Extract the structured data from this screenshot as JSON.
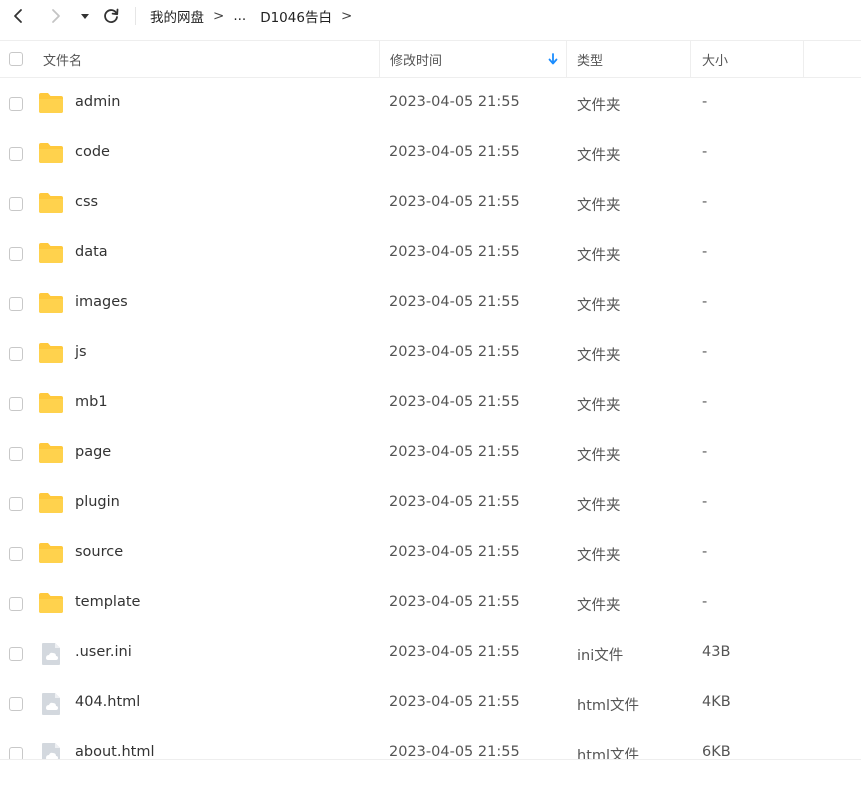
{
  "toolbar": {
    "back_icon": "chevron-left-icon",
    "forward_icon": "chevron-right-icon",
    "dropdown_icon": "caret-down-icon",
    "refresh_icon": "refresh-icon"
  },
  "breadcrumb": {
    "items": [
      "我的网盘",
      "...",
      "D1046告白"
    ],
    "separator": ">"
  },
  "table": {
    "columns": {
      "name": "文件名",
      "date": "修改时间",
      "type": "类型",
      "size": "大小"
    },
    "sort_icon": "arrow-down-icon",
    "sort_color": "#1a8cff",
    "folder_color": "#ffc93c",
    "rows": [
      {
        "name": "admin",
        "date": "2023-04-05 21:55",
        "type": "文件夹",
        "size": "-",
        "icon": "folder"
      },
      {
        "name": "code",
        "date": "2023-04-05 21:55",
        "type": "文件夹",
        "size": "-",
        "icon": "folder"
      },
      {
        "name": "css",
        "date": "2023-04-05 21:55",
        "type": "文件夹",
        "size": "-",
        "icon": "folder"
      },
      {
        "name": "data",
        "date": "2023-04-05 21:55",
        "type": "文件夹",
        "size": "-",
        "icon": "folder"
      },
      {
        "name": "images",
        "date": "2023-04-05 21:55",
        "type": "文件夹",
        "size": "-",
        "icon": "folder"
      },
      {
        "name": "js",
        "date": "2023-04-05 21:55",
        "type": "文件夹",
        "size": "-",
        "icon": "folder"
      },
      {
        "name": "mb1",
        "date": "2023-04-05 21:55",
        "type": "文件夹",
        "size": "-",
        "icon": "folder"
      },
      {
        "name": "page",
        "date": "2023-04-05 21:55",
        "type": "文件夹",
        "size": "-",
        "icon": "folder"
      },
      {
        "name": "plugin",
        "date": "2023-04-05 21:55",
        "type": "文件夹",
        "size": "-",
        "icon": "folder"
      },
      {
        "name": "source",
        "date": "2023-04-05 21:55",
        "type": "文件夹",
        "size": "-",
        "icon": "folder"
      },
      {
        "name": "template",
        "date": "2023-04-05 21:55",
        "type": "文件夹",
        "size": "-",
        "icon": "folder"
      },
      {
        "name": ".user.ini",
        "date": "2023-04-05 21:55",
        "type": "ini文件",
        "size": "43B",
        "icon": "file"
      },
      {
        "name": "404.html",
        "date": "2023-04-05 21:55",
        "type": "html文件",
        "size": "4KB",
        "icon": "file"
      },
      {
        "name": "about.html",
        "date": "2023-04-05 21:55",
        "type": "html文件",
        "size": "6KB",
        "icon": "file"
      }
    ]
  }
}
